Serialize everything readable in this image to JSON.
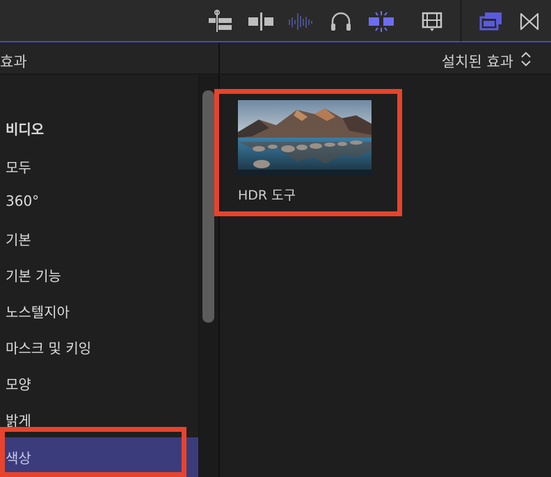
{
  "colors": {
    "accent": "#5a5adf",
    "selection": "#3b3c7c",
    "highlight": "#e8432c"
  },
  "toolbar": {
    "icons": [
      "clip-connect-icon",
      "insert-clip-icon",
      "audio-waveform-icon",
      "headphones-icon",
      "snapping-icon",
      "film-strip-icon",
      "overlay-windows-icon",
      "transitions-icon"
    ]
  },
  "header": {
    "left_title": "효과",
    "right_title": "설치된 효과"
  },
  "sidebar": {
    "items": [
      {
        "label": "비디오"
      },
      {
        "label": "모두"
      },
      {
        "label": "360°"
      },
      {
        "label": "기본"
      },
      {
        "label": "기본 기능"
      },
      {
        "label": "노스텔지아"
      },
      {
        "label": "마스크 및 키잉"
      },
      {
        "label": "모양"
      },
      {
        "label": "밝게"
      },
      {
        "label": "색상"
      }
    ],
    "selected": "색상"
  },
  "effects": [
    {
      "label": "HDR 도구"
    }
  ]
}
